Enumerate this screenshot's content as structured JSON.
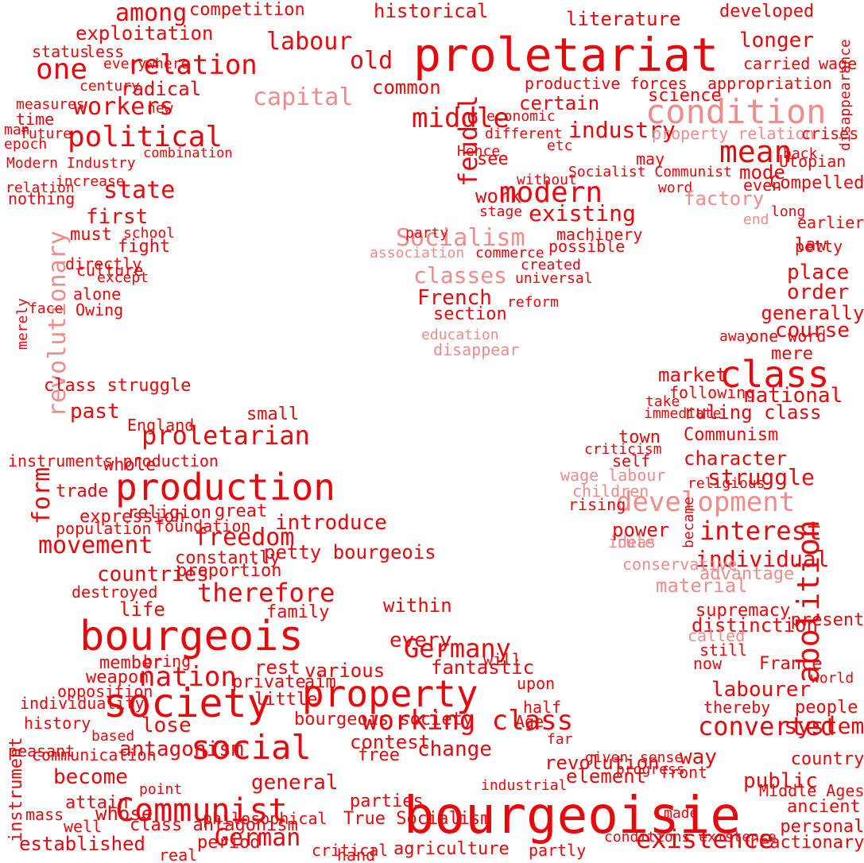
{
  "palette": {
    "main": "#e8070b",
    "light": "#f08c8c",
    "background": "#ffffff"
  },
  "words": [
    "proletariat",
    "bourgeoisie",
    "bourgeois",
    "condition",
    "class",
    "society",
    "production",
    "property",
    "development",
    "social",
    "Communist",
    "modern",
    "relation",
    "political",
    "one",
    "capital",
    "mean",
    "Socialism",
    "classes",
    "working class",
    "existence",
    "therefore",
    "proletarian",
    "interest",
    "labour",
    "feudal",
    "revolutionary",
    "abolition",
    "movement",
    "nation",
    "state",
    "industry",
    "German",
    "system",
    "labourer",
    "form",
    "historical",
    "competition",
    "exploitation",
    "literature",
    "developed",
    "longer",
    "carried",
    "wage",
    "productive forces",
    "appropriation",
    "science",
    "property relation",
    "crises",
    "Utopian",
    "Socialist Communist",
    "Modern Industry",
    "combination",
    "nothing",
    "first",
    "must",
    "fight",
    "existing",
    "party",
    "stage",
    "work",
    "machinery",
    "possible",
    "commerce",
    "association",
    "created",
    "universal",
    "French",
    "reform",
    "section",
    "education",
    "disappear",
    "order",
    "place",
    "law",
    "generally",
    "course",
    "national",
    "ruling class",
    "Communism",
    "character",
    "struggle",
    "criticism",
    "wage labour",
    "children",
    "power",
    "ideas",
    "individual",
    "material",
    "supremacy",
    "distinction",
    "called",
    "still",
    "now",
    "France",
    "people",
    "world",
    "present",
    "ancient",
    "personal",
    "reactionary",
    "way",
    "country",
    "public",
    "Middle Ages",
    "revolution",
    "change",
    "free",
    "industrial",
    "agriculture",
    "partly",
    "conditions existence",
    "whole",
    "freedom",
    "petty bourgeois",
    "proportion",
    "countries",
    "life",
    "family",
    "within",
    "every",
    "Germany",
    "various",
    "fantastic",
    "contest",
    "bourgeois society",
    "become",
    "antagonism",
    "history",
    "opposition",
    "peasant",
    "attain",
    "class antagonism",
    "established",
    "real",
    "philosophical",
    "general",
    "parties",
    "True Socialism",
    "period",
    "critical",
    "hand",
    "past",
    "small",
    "England",
    "trade",
    "expression",
    "population",
    "religion",
    "foundation",
    "great",
    "introduce",
    "constantly",
    "destroyed",
    "class struggle",
    "instruments production",
    "merely",
    "face",
    "directly",
    "culture",
    "alone",
    "Owing",
    "school",
    "except",
    "future",
    "relation",
    "increase",
    "everywhere",
    "radical",
    "new",
    "time",
    "workers",
    "among",
    "status",
    "less",
    "century",
    "measures",
    "man",
    "epoch",
    "old",
    "common",
    "middle",
    "certain",
    "economic",
    "different",
    "etc",
    "see",
    "Hence",
    "without",
    "word",
    "may",
    "mode",
    "even",
    "Compelled",
    "earlier",
    "petty",
    "disappearance",
    "back",
    "factory",
    "long",
    "end",
    "one word",
    "away",
    "mere",
    "market",
    "following",
    "take",
    "immediate",
    "town",
    "self",
    "religious",
    "rising",
    "rule",
    "conservative",
    "became",
    "advantage",
    "member",
    "bring",
    "weapon",
    "rest",
    "private",
    "aim",
    "little",
    "upon",
    "will",
    "thereby",
    "converted",
    "half",
    "Age",
    "far",
    "given",
    "element",
    "progress",
    "front",
    "sense",
    "made",
    "point",
    "well",
    "mass",
    "whose",
    "based",
    "lose",
    "individuality",
    "communication",
    "instrument"
  ]
}
